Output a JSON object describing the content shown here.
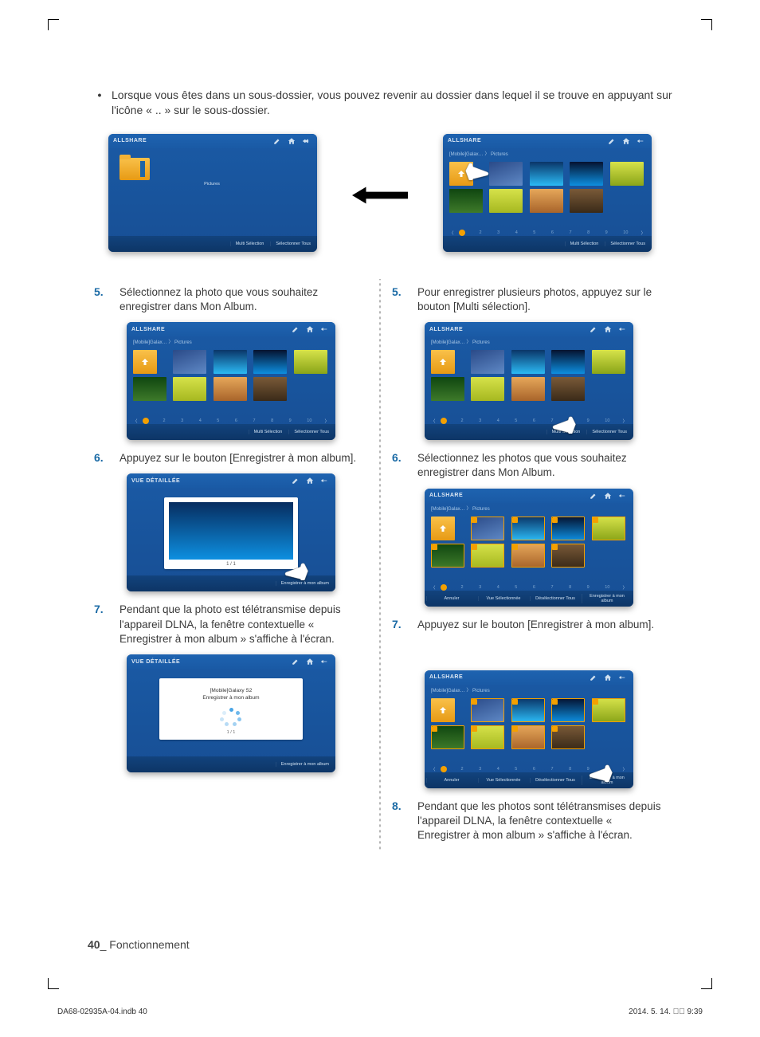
{
  "intro": {
    "bullet": "•",
    "text": "Lorsque vous êtes dans un sous-dossier, vous pouvez revenir au dossier dans lequel il se trouve en appuyant sur l'icône « .. » sur le sous-dossier."
  },
  "screenshot_common": {
    "app_title_allshare": "ALLSHARE",
    "app_title_detail": "VUE DÉTAILLÉE",
    "breadcrumb": "[Mobile]Galax…   〉   Pictures",
    "folder_caption": "Pictures",
    "pager_numbers": [
      "1",
      "2",
      "3",
      "4",
      "5",
      "6",
      "7",
      "8",
      "9",
      "10"
    ],
    "footer": {
      "multi_selection": "Multi Sélection",
      "select_all": "Sélectionner Tous",
      "cancel": "Annuler",
      "view_selected": "Vue Sélectionnée",
      "deselect_all": "Désélectionner Tous",
      "save_album": "Enregistrer à mon album"
    },
    "detail_counter": "1 / 1",
    "popup_line1": "[Mobile]Galaxy S2",
    "popup_line2": "Enregistrer à mon album"
  },
  "left_steps": [
    {
      "num": "5.",
      "text": "Sélectionnez la photo que vous souhaitez enregistrer dans Mon Album."
    },
    {
      "num": "6.",
      "text": "Appuyez sur le bouton [Enregistrer à mon album]."
    },
    {
      "num": "7.",
      "text": "Pendant que la photo est télétransmise depuis l'appareil DLNA, la fenêtre contextuelle « Enregistrer à mon album » s'affiche à l'écran."
    }
  ],
  "right_steps": [
    {
      "num": "5.",
      "text": "Pour enregistrer plusieurs photos, appuyez sur le bouton [Multi sélection]."
    },
    {
      "num": "6.",
      "text": "Sélectionnez les photos que vous souhaitez enregistrer dans Mon Album."
    },
    {
      "num": "7.",
      "text": "Appuyez sur le bouton [Enregistrer à mon album]."
    },
    {
      "num": "8.",
      "text": "Pendant que les photos sont télétransmises depuis l'appareil DLNA, la fenêtre contextuelle « Enregistrer à mon album » s'affiche à l'écran."
    }
  ],
  "footer": {
    "page_number": "40",
    "section": "Fonctionnement",
    "indd_file": "DA68-02935A-04.indb   40",
    "indd_date": "2014. 5. 14.   \u0000\u0000 9:39"
  }
}
